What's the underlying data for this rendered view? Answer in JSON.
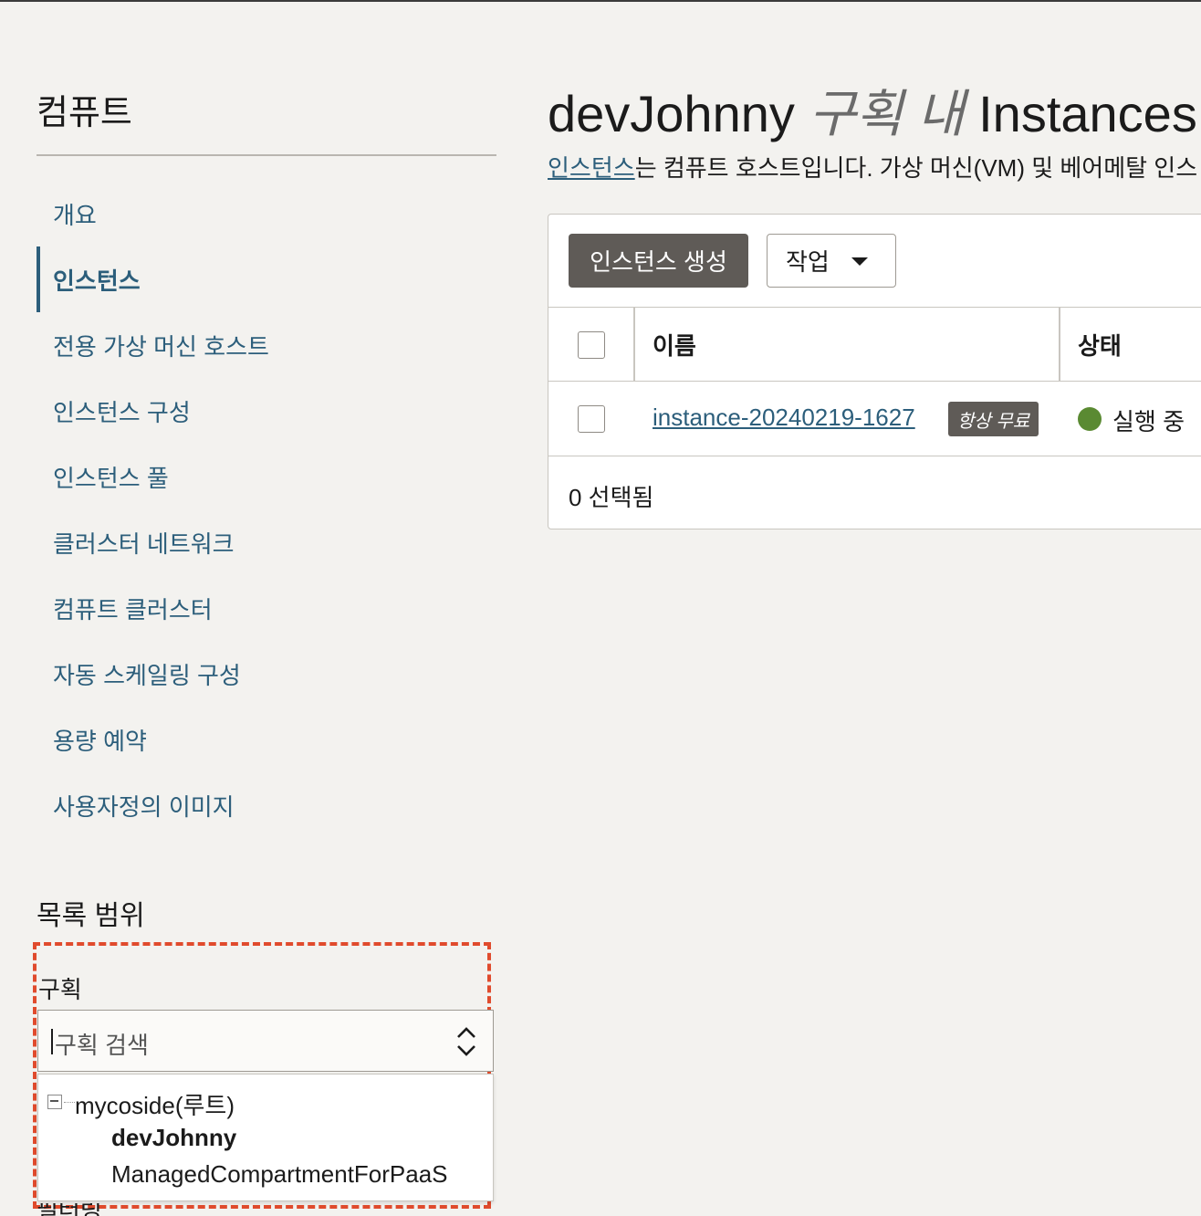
{
  "sidebar": {
    "title": "컴퓨트",
    "items": [
      {
        "label": "개요"
      },
      {
        "label": "인스턴스"
      },
      {
        "label": "전용 가상 머신 호스트"
      },
      {
        "label": "인스턴스 구성"
      },
      {
        "label": "인스턴스 풀"
      },
      {
        "label": "클러스터 네트워크"
      },
      {
        "label": "컴퓨트 클러스터"
      },
      {
        "label": "자동 스케일링 구성"
      },
      {
        "label": "용량 예약"
      },
      {
        "label": "사용자정의 이미지"
      }
    ],
    "active_item": "인스턴스"
  },
  "list_scope": {
    "title": "목록 범위",
    "compartment_label": "구획",
    "compartment_placeholder": "구획 검색",
    "tree": {
      "root": "mycoside(루트)",
      "children": [
        "devJohnny",
        "ManagedCompartmentForPaaS"
      ]
    },
    "cut_off_label": "필터링"
  },
  "main": {
    "heading_compartment": "devJohnny",
    "heading_in": "구획 내",
    "heading_resource": "Instances",
    "description_link": "인스턴스",
    "description_text": "는 컴퓨트 호스트입니다. 가상 머신(VM) 및 베어메탈 인스",
    "toolbar": {
      "create_label": "인스턴스 생성",
      "actions_label": "작업"
    },
    "table": {
      "columns": [
        "이름",
        "상태"
      ],
      "rows": [
        {
          "name": "instance-20240219-1627",
          "badge": "항상 무료",
          "status": "실행 중"
        }
      ]
    },
    "selected_count": "0 선택됨"
  },
  "colors": {
    "link": "#2c5e7b",
    "primary_button": "#5f5b57",
    "status_running": "#5a8a32",
    "highlight_dashed": "#e04b2d"
  }
}
